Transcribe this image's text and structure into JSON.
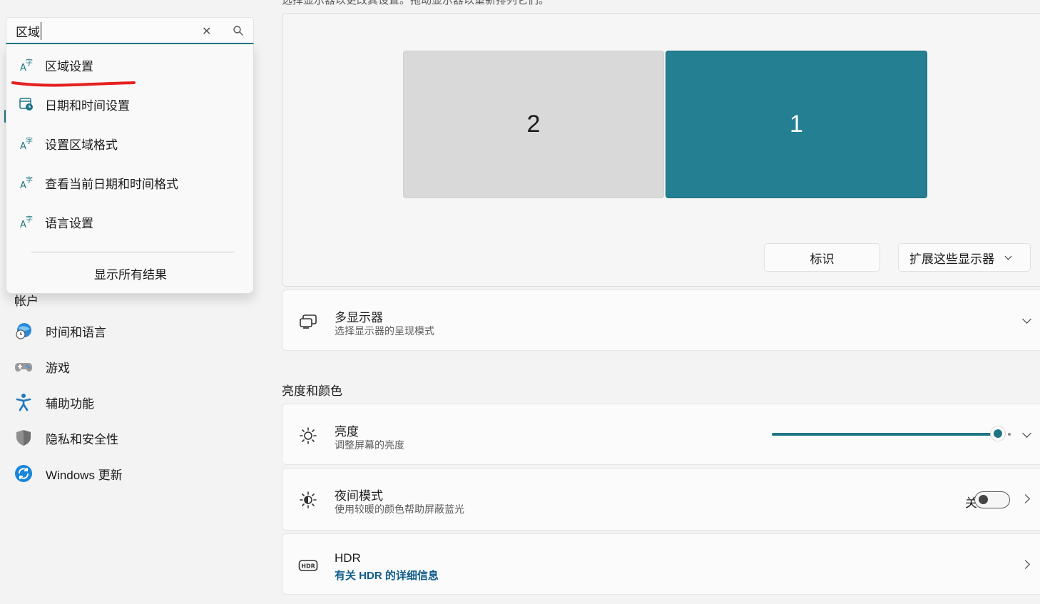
{
  "top_instruction": "选择显示器以更改其设置。拖动显示器以重新排列它们。",
  "search": {
    "value": "区域",
    "clear_icon": "close-icon",
    "search_icon": "search-icon"
  },
  "search_results": [
    {
      "label": "区域设置",
      "icon": "language-icon"
    },
    {
      "label": "日期和时间设置",
      "icon": "date-time-icon"
    },
    {
      "label": "设置区域格式",
      "icon": "language-icon"
    },
    {
      "label": "查看当前日期和时间格式",
      "icon": "language-icon"
    },
    {
      "label": "语言设置",
      "icon": "language-icon"
    }
  ],
  "show_all_results": "显示所有结果",
  "sidebar": {
    "partial_item": "帐户",
    "items": [
      {
        "label": "时间和语言",
        "icon": "globe-clock-icon"
      },
      {
        "label": "游戏",
        "icon": "gamepad-icon"
      },
      {
        "label": "辅助功能",
        "icon": "accessibility-icon"
      },
      {
        "label": "隐私和安全性",
        "icon": "shield-icon"
      },
      {
        "label": "Windows 更新",
        "icon": "update-icon"
      }
    ]
  },
  "display": {
    "monitors": [
      "2",
      "1"
    ],
    "identify_label": "标识",
    "extend_label": "扩展这些显示器"
  },
  "multi_display": {
    "title": "多显示器",
    "subtitle": "选择显示器的呈现模式"
  },
  "section_brightness": "亮度和颜色",
  "brightness": {
    "title": "亮度",
    "subtitle": "调整屏幕的亮度",
    "level_percent": 100
  },
  "night_light": {
    "title": "夜间模式",
    "subtitle": "使用较暖的颜色帮助屏蔽蓝光",
    "state": "关"
  },
  "hdr": {
    "title": "HDR",
    "link": "有关 HDR 的详细信息"
  },
  "colors": {
    "accent": "#1f7585",
    "monitor_selected": "#237f91",
    "monitor_other": "#d9d9d9",
    "annotation_red": "#e52020"
  }
}
